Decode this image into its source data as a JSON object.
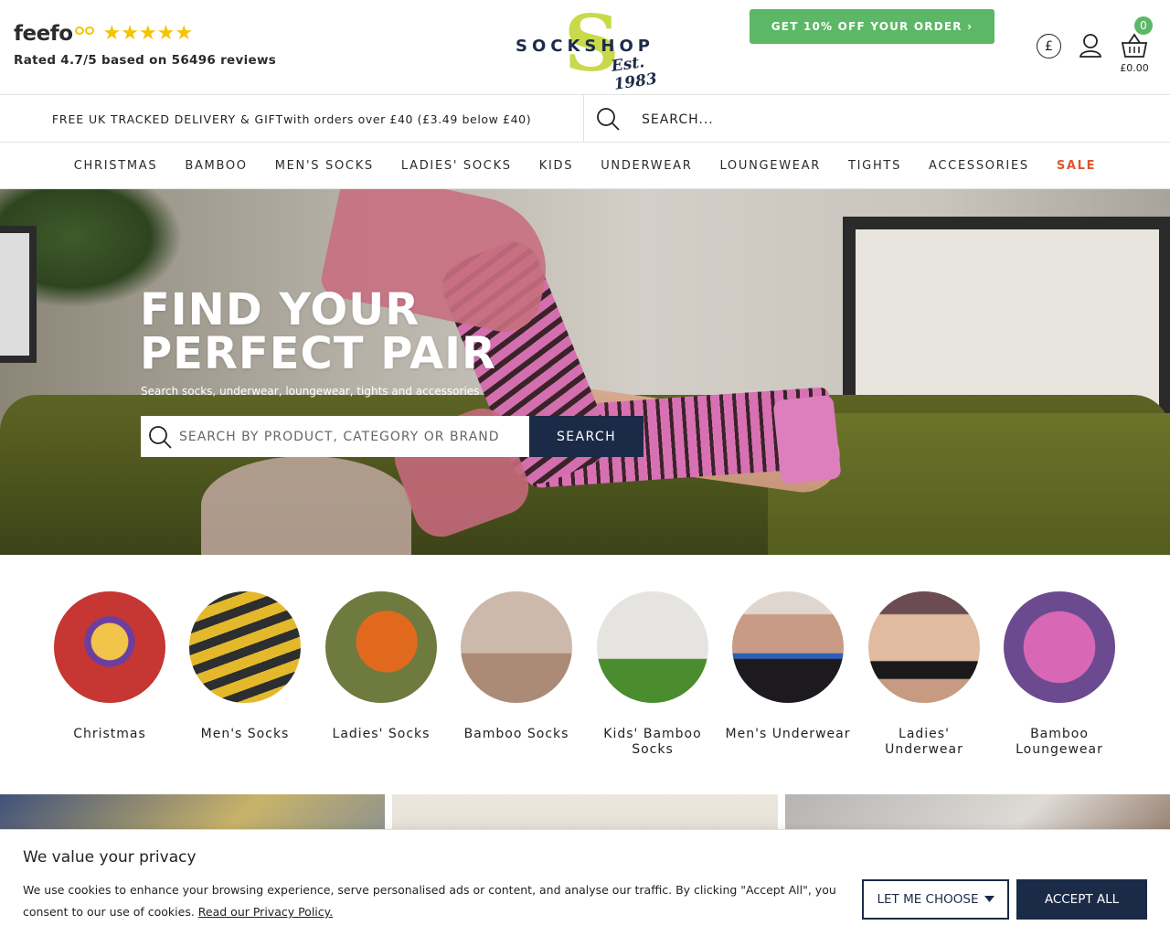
{
  "feefo": {
    "logo": "feefo",
    "stars": "★★★★★",
    "rating_text": "Rated 4.7/5 based on 56496 reviews"
  },
  "brand": {
    "name": "SOCKSHOP",
    "monogram": "S",
    "est": "Est. 1983",
    "accent_color": "#c8da4c",
    "navy_color": "#1a2a47"
  },
  "header": {
    "promo_label": "GET 10% OFF YOUR ORDER ›",
    "currency_symbol": "£",
    "basket_count": "0",
    "basket_total": "£0.00"
  },
  "delivery": {
    "text_caps": "FREE UK TRACKED DELIVERY & GIFT",
    "text_rest": " with orders over £40 (£3.49 below £40)"
  },
  "top_search": {
    "placeholder": "SEARCH..."
  },
  "nav": {
    "items": [
      "CHRISTMAS",
      "BAMBOO",
      "MEN'S SOCKS",
      "LADIES' SOCKS",
      "KIDS",
      "UNDERWEAR",
      "LOUNGEWEAR",
      "TIGHTS",
      "ACCESSORIES",
      "SALE"
    ]
  },
  "hero": {
    "title_line1": "FIND YOUR",
    "title_line2": "PERFECT PAIR",
    "subtitle": "Search socks, underwear, loungewear, tights and accessories",
    "search_placeholder": "SEARCH BY PRODUCT, CATEGORY OR BRAND",
    "search_button": "SEARCH"
  },
  "categories": [
    {
      "label": "Christmas"
    },
    {
      "label": "Men's Socks"
    },
    {
      "label": "Ladies' Socks"
    },
    {
      "label": "Bamboo Socks"
    },
    {
      "label": "Kids' Bamboo Socks"
    },
    {
      "label": "Men's Underwear"
    },
    {
      "label": "Ladies' Underwear"
    },
    {
      "label": "Bamboo Loungewear"
    }
  ],
  "cookie": {
    "title": "We value your privacy",
    "text": "We use cookies to enhance your browsing experience, serve personalised ads or content, and analyse our traffic. By clicking \"Accept All\", you consent to our use of cookies. ",
    "link": "Read our Privacy Policy.",
    "choose_label": "LET ME CHOOSE",
    "accept_label": "ACCEPT ALL"
  }
}
